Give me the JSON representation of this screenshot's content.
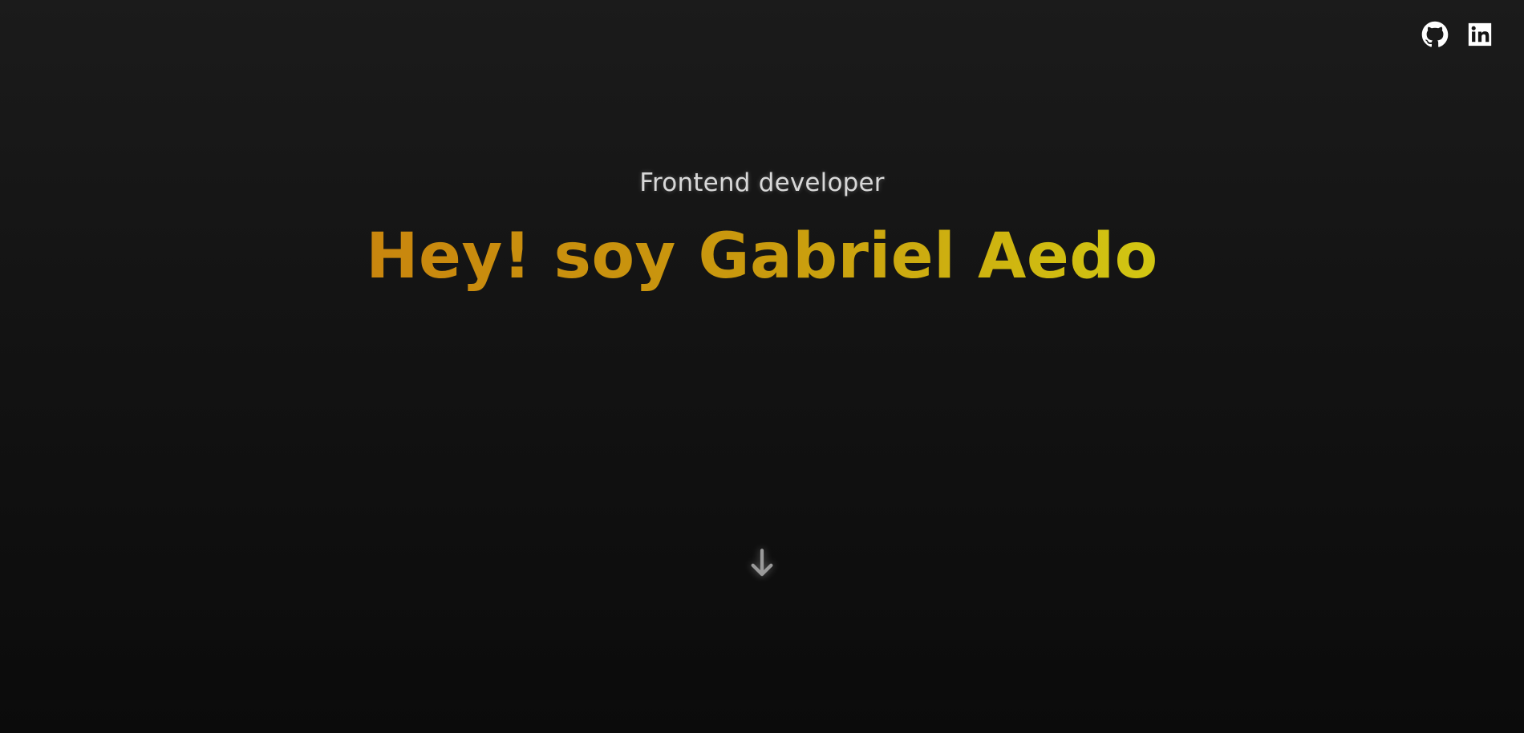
{
  "social": {
    "github": {
      "icon": "github-icon"
    },
    "linkedin": {
      "icon": "linkedin-icon"
    }
  },
  "hero": {
    "subtitle": "Frontend developer",
    "title": "Hey! soy Gabriel Aedo"
  },
  "scroll": {
    "icon": "arrow-down-icon"
  },
  "colors": {
    "background_top": "#1b1b1b",
    "background_bottom": "#0b0b0b",
    "subtitle": "#d8d8d8",
    "title_gradient_start": "#c9860e",
    "title_gradient_end": "#d2c712",
    "icons": "#ffffff",
    "arrow": "#9a9a9a"
  }
}
